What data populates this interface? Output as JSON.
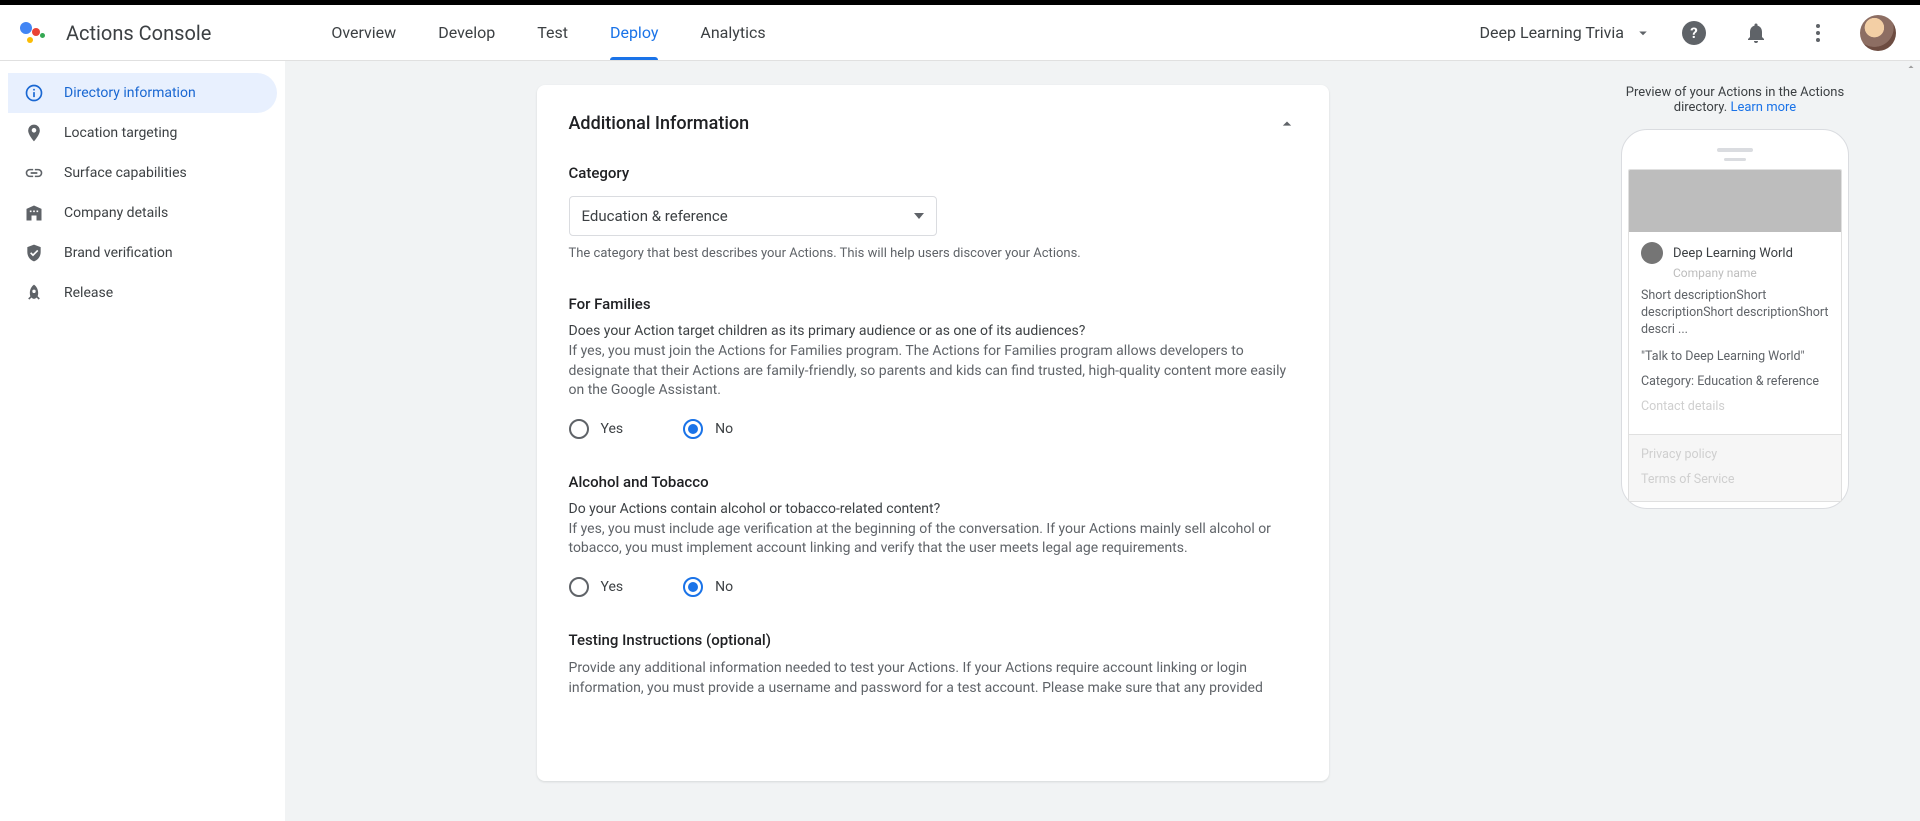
{
  "header": {
    "app_title": "Actions Console",
    "tabs": [
      "Overview",
      "Develop",
      "Test",
      "Deploy",
      "Analytics"
    ],
    "active_tab_index": 3,
    "project_name": "Deep Learning Trivia"
  },
  "sidebar": {
    "items": [
      {
        "label": "Directory information"
      },
      {
        "label": "Location targeting"
      },
      {
        "label": "Surface capabilities"
      },
      {
        "label": "Company details"
      },
      {
        "label": "Brand verification"
      },
      {
        "label": "Release"
      }
    ],
    "active_index": 0
  },
  "card": {
    "title": "Additional Information",
    "category": {
      "label": "Category",
      "value": "Education & reference",
      "helper": "The category that best describes your Actions. This will help users discover your Actions."
    },
    "families": {
      "title": "For Families",
      "question": "Does your Action target children as its primary audience or as one of its audiences?",
      "desc": "If yes, you must join the Actions for Families program. The Actions for Families program allows developers to designate that their Actions are family-friendly, so parents and kids can find trusted, high-quality content more easily on the Google Assistant.",
      "yes": "Yes",
      "no": "No",
      "selected": "no"
    },
    "alcohol": {
      "title": "Alcohol and Tobacco",
      "question": "Do your Actions contain alcohol or tobacco-related content?",
      "desc": "If yes, you must include age verification at the beginning of the conversation. If your Actions mainly sell alcohol or tobacco, you must implement account linking and verify that the user meets legal age requirements.",
      "yes": "Yes",
      "no": "No",
      "selected": "no"
    },
    "testing": {
      "title": "Testing Instructions (optional)",
      "desc": "Provide any additional information needed to test your Actions. If your Actions require account linking or login information, you must provide a username and password for a test account. Please make sure that any provided"
    }
  },
  "preview": {
    "caption_pre": "Preview of your Actions in the Actions directory. ",
    "caption_link": "Learn more",
    "app_name": "Deep Learning World",
    "company_placeholder": "Company name",
    "short_desc": "Short descriptionShort descriptionShort descriptionShort descri ...",
    "talk": "\"Talk to Deep Learning World\"",
    "category": "Category: Education & reference",
    "contact": "Contact details",
    "privacy": "Privacy policy",
    "tos": "Terms of Service"
  }
}
